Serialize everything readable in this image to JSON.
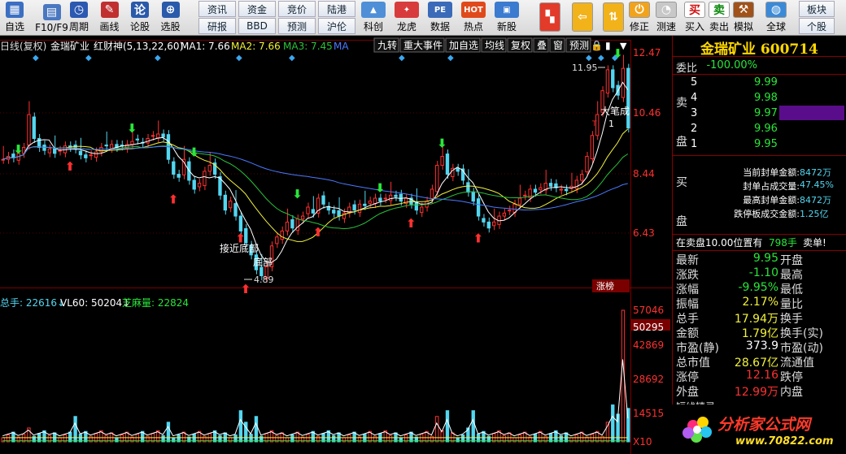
{
  "toolbar": {
    "buttons": [
      {
        "label": "自选",
        "icon": "grid-icon",
        "color": "#3b6fc2"
      },
      {
        "label": "F10/F9",
        "icon": "document-icon",
        "color": "#4a78c0"
      },
      {
        "label": "周期",
        "icon": "clock-icon",
        "color": "#2b58b0"
      },
      {
        "label": "画线",
        "icon": "pen-icon",
        "color": "#c03030"
      },
      {
        "label": "论股",
        "icon": "quote-icon",
        "color": "#2a5aaa"
      },
      {
        "label": "选股",
        "icon": "magnifier-icon",
        "color": "#2a5aaa"
      }
    ],
    "text_buttons_top": [
      "资讯",
      "资金",
      "竞价",
      "陆港"
    ],
    "text_buttons_bottom": [
      "研报",
      "BBD",
      "预测",
      "沪伦"
    ],
    "buttons2": [
      {
        "label": "科创",
        "icon": "chart-icon"
      },
      {
        "label": "龙虎",
        "icon": "dragon-icon"
      },
      {
        "label": "数据",
        "icon": "pe-icon"
      },
      {
        "label": "热点",
        "icon": "hot-icon"
      },
      {
        "label": "新股",
        "icon": "new-stock-icon"
      }
    ],
    "buttons3": [
      {
        "label": "",
        "icon": "multi-window-icon"
      },
      {
        "label": "",
        "icon": "back-arrow-icon"
      },
      {
        "label": "",
        "icon": "up-down-icon"
      },
      {
        "label": "修正",
        "icon": "power-icon"
      },
      {
        "label": "测速",
        "icon": "stopwatch-icon"
      },
      {
        "label": "买入",
        "icon": "buy-icon"
      },
      {
        "label": "卖出",
        "icon": "sell-icon"
      },
      {
        "label": "模拟",
        "icon": "hammer-icon"
      },
      {
        "label": "全球",
        "icon": "globe-icon"
      }
    ],
    "right_top": "板块",
    "right_bottom": "个股",
    "buy_char": "买",
    "sell_char": "卖"
  },
  "chart": {
    "header": {
      "period": "日线(复权)",
      "name": "金瑞矿业",
      "indicator": "红财神(5,13,22,60)",
      "ma1": "MA1: 7.66",
      "ma2": "MA2: 7.66",
      "ma3": "MA3: 7.45",
      "ma4": "MA"
    },
    "menu": [
      "九转",
      "重大事件",
      "加自选",
      "均线",
      "复权",
      "叠",
      "窗",
      "预测"
    ],
    "price_axis": [
      "12.47",
      "10.46",
      "8.44",
      "6.43"
    ],
    "vol_axis": [
      "57046",
      "50295",
      "42869",
      "28692",
      "14515",
      "X10"
    ],
    "vol_header": {
      "total": "总手: 22616↓",
      "vl60": "VL60: 50204↓",
      "sesame": "芝麻量: 22824"
    },
    "annotations": {
      "high": "11.95",
      "low": "4.89",
      "big": "大笔成",
      "t1": "T",
      "one": "1",
      "near_bottom": "接近底部",
      "bottom": "底部",
      "rank": "涨榜"
    }
  },
  "side": {
    "title": "金瑞矿业 600714",
    "weibi_label": "委比",
    "weibi": "-100.00%",
    "sell_label": "卖盘",
    "buy_label": "买盘",
    "sell_levels": [
      {
        "n": "5",
        "p": "9.99"
      },
      {
        "n": "4",
        "p": "9.98"
      },
      {
        "n": "3",
        "p": "9.97"
      },
      {
        "n": "2",
        "p": "9.96"
      },
      {
        "n": "1",
        "p": "9.95"
      }
    ],
    "seal": [
      {
        "label": "当前封单金额:",
        "value": "8472万"
      },
      {
        "label": "封单占成交量:",
        "value": "47.45%"
      },
      {
        "label": "最高封单金额:",
        "value": "8472万"
      },
      {
        "label": "跌停板成交金额:",
        "value": "1.25亿"
      }
    ],
    "position": "在卖盘10.00位置有",
    "position_qty": "798手",
    "position_tail": "卖单!",
    "stats": [
      {
        "l": "最新",
        "v": "9.95",
        "c": "g",
        "l2": "开盘",
        "v2": ""
      },
      {
        "l": "涨跌",
        "v": "-1.10",
        "c": "g",
        "l2": "最高",
        "v2": ""
      },
      {
        "l": "涨幅",
        "v": "-9.95%",
        "c": "g",
        "l2": "最低",
        "v2": ""
      },
      {
        "l": "振幅",
        "v": "2.17%",
        "c": "y",
        "l2": "量比",
        "v2": ""
      },
      {
        "l": "总手",
        "v": "17.94万",
        "c": "y",
        "l2": "换手",
        "v2": ""
      },
      {
        "l": "金额",
        "v": "1.79亿",
        "c": "y",
        "l2": "换手(实)",
        "v2": ""
      },
      {
        "l": "市盈(静)",
        "v": "373.9",
        "c": "w",
        "l2": "市盈(动)",
        "v2": ""
      },
      {
        "l": "总市值",
        "v": "28.67亿",
        "c": "y",
        "l2": "流通值",
        "v2": ""
      },
      {
        "l": "涨停",
        "v": "12.16",
        "c": "r",
        "l2": "跌停",
        "v2": ""
      },
      {
        "l": "外盘",
        "v": "12.99万",
        "c": "r",
        "l2": "内盘",
        "v2": ""
      }
    ],
    "short_title": "短线精灵",
    "logo_text": "分析家公式网",
    "logo_url": "www.70822.com"
  }
}
